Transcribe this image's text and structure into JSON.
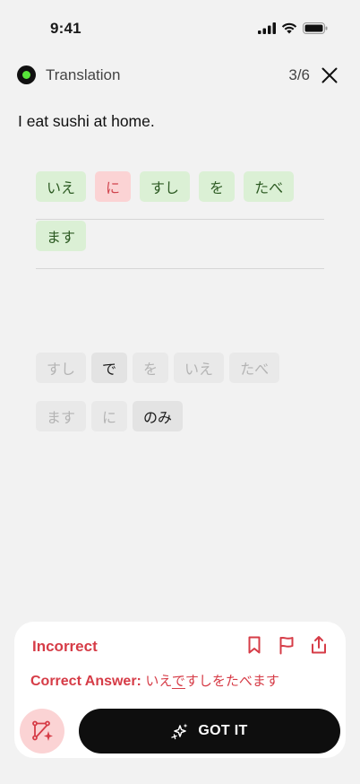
{
  "status_bar": {
    "time": "9:41"
  },
  "header": {
    "title": "Translation",
    "progress": "3/6"
  },
  "prompt": "I eat sushi at home.",
  "answer_lines": [
    [
      {
        "text": "いえ",
        "state": "correct"
      },
      {
        "text": "に",
        "state": "wrong"
      },
      {
        "text": "すし",
        "state": "correct"
      },
      {
        "text": "を",
        "state": "correct"
      },
      {
        "text": "たべ",
        "state": "correct"
      }
    ],
    [
      {
        "text": "ます",
        "state": "correct"
      }
    ]
  ],
  "word_bank": [
    {
      "text": "すし",
      "used": true
    },
    {
      "text": "で",
      "used": false
    },
    {
      "text": "を",
      "used": true
    },
    {
      "text": "いえ",
      "used": true
    },
    {
      "text": "たべ",
      "used": true
    },
    {
      "text": "ます",
      "used": true
    },
    {
      "text": "に",
      "used": true
    },
    {
      "text": "のみ",
      "used": false
    }
  ],
  "feedback": {
    "status": "Incorrect",
    "answer_label": "Correct Answer:",
    "answer_before": "いえ",
    "answer_highlight": "で",
    "answer_after": "すしをたべます"
  },
  "primary_button": {
    "label": "GOT IT"
  },
  "colors": {
    "error": "#d63c47",
    "correct_chip": "#dbf0d5",
    "wrong_chip": "#fbd3d4",
    "status_dot": "#58e53a"
  }
}
